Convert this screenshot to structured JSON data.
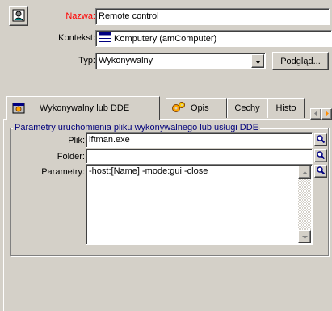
{
  "header": {
    "name_label": "Nazwa:",
    "name_value": "Remote control",
    "context_label": "Kontekst:",
    "context_value": "Komputery (amComputer)",
    "type_label": "Typ:",
    "type_value": "Wykonywalny",
    "preview_button": "Podgląd..."
  },
  "tabs": [
    {
      "label": "Wykonywalny lub DDE",
      "icon": "gear-executable-icon"
    },
    {
      "label": "Opis",
      "icon": "gears-icon"
    },
    {
      "label": "Cechy"
    },
    {
      "label": "Histo"
    }
  ],
  "group": {
    "title": "Parametry uruchomienia pliku wykonywalnego lub usługi DDE",
    "file_label": "Plik:",
    "file_value": "iftman.exe",
    "folder_label": "Folder:",
    "folder_value": "",
    "params_label": "Parametry:",
    "params_value": "-host:[Name] -mode:gui -close"
  },
  "colors": {
    "required_label": "#ff0000",
    "group_title": "#00007b",
    "background": "#d4d0c8"
  }
}
